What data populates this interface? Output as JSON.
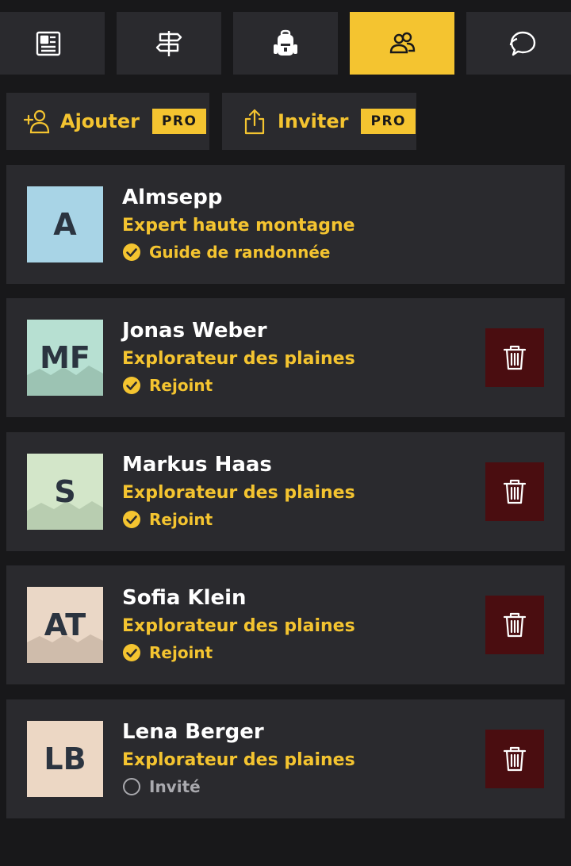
{
  "tabs": [
    {
      "icon": "newspaper-icon",
      "active": false
    },
    {
      "icon": "signpost-icon",
      "active": false
    },
    {
      "icon": "backpack-icon",
      "active": false
    },
    {
      "icon": "group-icon",
      "active": true
    },
    {
      "icon": "chat-bubbles-icon",
      "active": false
    }
  ],
  "actions": {
    "add_label": "Ajouter",
    "add_badge": "PRO",
    "invite_label": "Inviter",
    "invite_badge": "PRO"
  },
  "colors": {
    "accent": "#f4c430",
    "background": "#18181a",
    "card": "#2a2a2e",
    "delete": "#4a0d10"
  },
  "members": [
    {
      "initials": "A",
      "name": "Almsepp",
      "role": "Expert haute montagne",
      "status": "Guide de randonnée",
      "status_state": "verified",
      "avatar_bg": "#a8d4e6",
      "deletable": false
    },
    {
      "initials": "MF",
      "name": "Jonas Weber",
      "role": "Explorateur des plaines",
      "status": "Rejoint",
      "status_state": "verified",
      "avatar_bg": "#b7e0d2",
      "deletable": true
    },
    {
      "initials": "S",
      "name": "Markus Haas",
      "role": "Explorateur des plaines",
      "status": "Rejoint",
      "status_state": "verified",
      "avatar_bg": "#d3e6c9",
      "deletable": true
    },
    {
      "initials": "AT",
      "name": "Sofia Klein",
      "role": "Explorateur des plaines",
      "status": "Rejoint",
      "status_state": "verified",
      "avatar_bg": "#ead7c6",
      "deletable": true
    },
    {
      "initials": "LB",
      "name": "Lena Berger",
      "role": "Explorateur des plaines",
      "status": "Invité",
      "status_state": "pending",
      "avatar_bg": "#ecd7c4",
      "deletable": true
    }
  ]
}
